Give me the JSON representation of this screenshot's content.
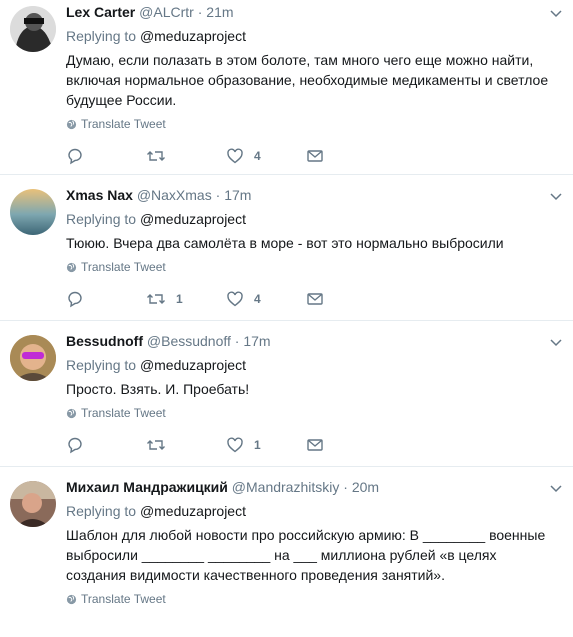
{
  "translate_label": "Translate Tweet",
  "replying_prefix": "Replying to",
  "tweets": [
    {
      "name": "Lex Carter",
      "handle": "@ALCrtr",
      "time": "21m",
      "replying_to": "@meduzaproject",
      "text": "Думаю, если полазать в этом болоте, там много чего еще можно найти, включая нормальное образование, необходимые медикаменты и светлое будущее России.",
      "retweets": "",
      "likes": "4"
    },
    {
      "name": "Xmas Nax",
      "handle": "@NaxXmas",
      "time": "17m",
      "replying_to": "@meduzaproject",
      "text": "Тююю. Вчера два самолёта в море - вот это нормально выбросили",
      "retweets": "1",
      "likes": "4"
    },
    {
      "name": "Bessudnoff",
      "handle": "@Bessudnoff",
      "time": "17m",
      "replying_to": "@meduzaproject",
      "text": "Просто. Взять. И. Проебать!",
      "retweets": "",
      "likes": "1"
    },
    {
      "name": "Михаил Мандражицкий",
      "handle": "@Mandrazhitskiy",
      "time": "20m",
      "replying_to": "@meduzaproject",
      "text": "Шаблон для любой новости про российскую армию: В ________ военные выбросили ________ ________ на ___ миллиона рублей «в целях создания видимости качественного проведения занятий».",
      "retweets": "",
      "likes": ""
    }
  ]
}
